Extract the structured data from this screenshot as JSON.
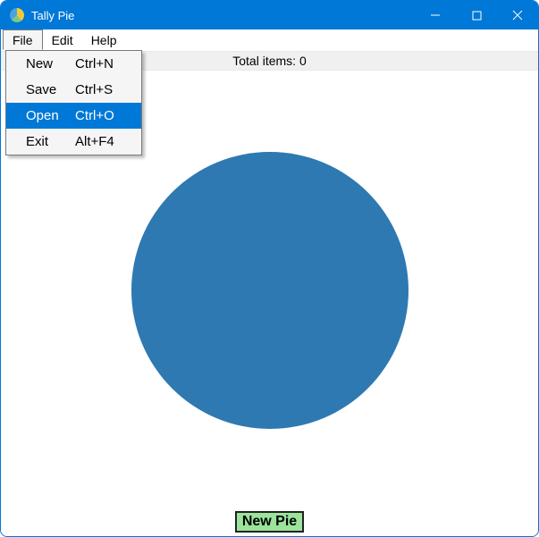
{
  "window": {
    "title": "Tally Pie"
  },
  "menubar": {
    "items": [
      "File",
      "Edit",
      "Help"
    ],
    "open_index": 0
  },
  "file_menu": {
    "items": [
      {
        "label": "New",
        "shortcut": "Ctrl+N",
        "selected": false
      },
      {
        "label": "Save",
        "shortcut": "Ctrl+S",
        "selected": false
      },
      {
        "label": "Open",
        "shortcut": "Ctrl+O",
        "selected": true
      },
      {
        "label": "Exit",
        "shortcut": "Alt+F4",
        "selected": false
      }
    ]
  },
  "status": {
    "total_items_label": "Total items: 0"
  },
  "buttons": {
    "new_pie": "New Pie"
  },
  "colors": {
    "titlebar": "#0078d7",
    "pie_fill": "#2e79b1",
    "new_pie_bg": "#9be49b",
    "menu_highlight": "#0078d7"
  },
  "chart_data": {
    "type": "pie",
    "title": "",
    "slices": [
      {
        "label": "",
        "value": 1,
        "color": "#2e79b1"
      }
    ],
    "total_items": 0
  }
}
